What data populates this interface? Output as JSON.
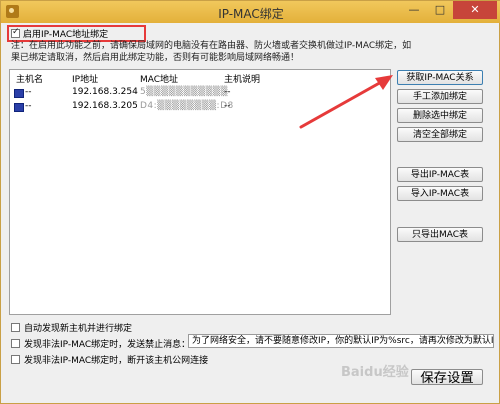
{
  "window": {
    "title": "IP-MAC绑定",
    "controls": {
      "minimize": "—",
      "maximize": "□",
      "close": "✕"
    }
  },
  "enable": {
    "label": "启用IP-MAC地址绑定",
    "checked": true
  },
  "note": "注：在启用此功能之前，请确保局域网的电脑没有在路由器、防火墙或者交换机做过IP-MAC绑定，如果已绑定请取消，然后启用此绑定功能，否则有可能影响局域网络畅通！",
  "table": {
    "columns": [
      "主机名",
      "IP地址",
      "MAC地址",
      "主机说明"
    ],
    "rows": [
      {
        "host": "--",
        "ip": "192.168.3.254",
        "mac": "5▒▒▒▒▒▒▒▒▒▒▒",
        "desc": "--"
      },
      {
        "host": "--",
        "ip": "192.168.3.205",
        "mac": "D4:▒▒▒▒▒▒▒▒:D8",
        "desc": "--"
      }
    ]
  },
  "buttons": {
    "get_ip_mac": "获取IP-MAC关系",
    "manual_add": "手工添加绑定",
    "delete_selected": "删除选中绑定",
    "clear_all": "清空全部绑定",
    "export_ip_mac": "导出IP-MAC表",
    "import_ip_mac": "导入IP-MAC表",
    "export_mac_only": "只导出MAC表",
    "save": "保存设置"
  },
  "options": {
    "auto_discover": {
      "label": "自动发现新主机并进行绑定",
      "checked": false
    },
    "warn_illegal": {
      "label": "发现非法IP-MAC绑定时，发送禁止消息：",
      "checked": false
    },
    "disconnect_illegal": {
      "label": "发现非法IP-MAC绑定时，断开该主机公网连接",
      "checked": false
    }
  },
  "message_input": {
    "value": "为了网络安全，请不要随意修改IP，你的默认IP为%src，请再次修改为默认IP"
  },
  "watermark": "Baidu经验",
  "colors": {
    "titlebar": "#e3b03a",
    "highlight": "#e63a3a",
    "close": "#c7453a"
  }
}
